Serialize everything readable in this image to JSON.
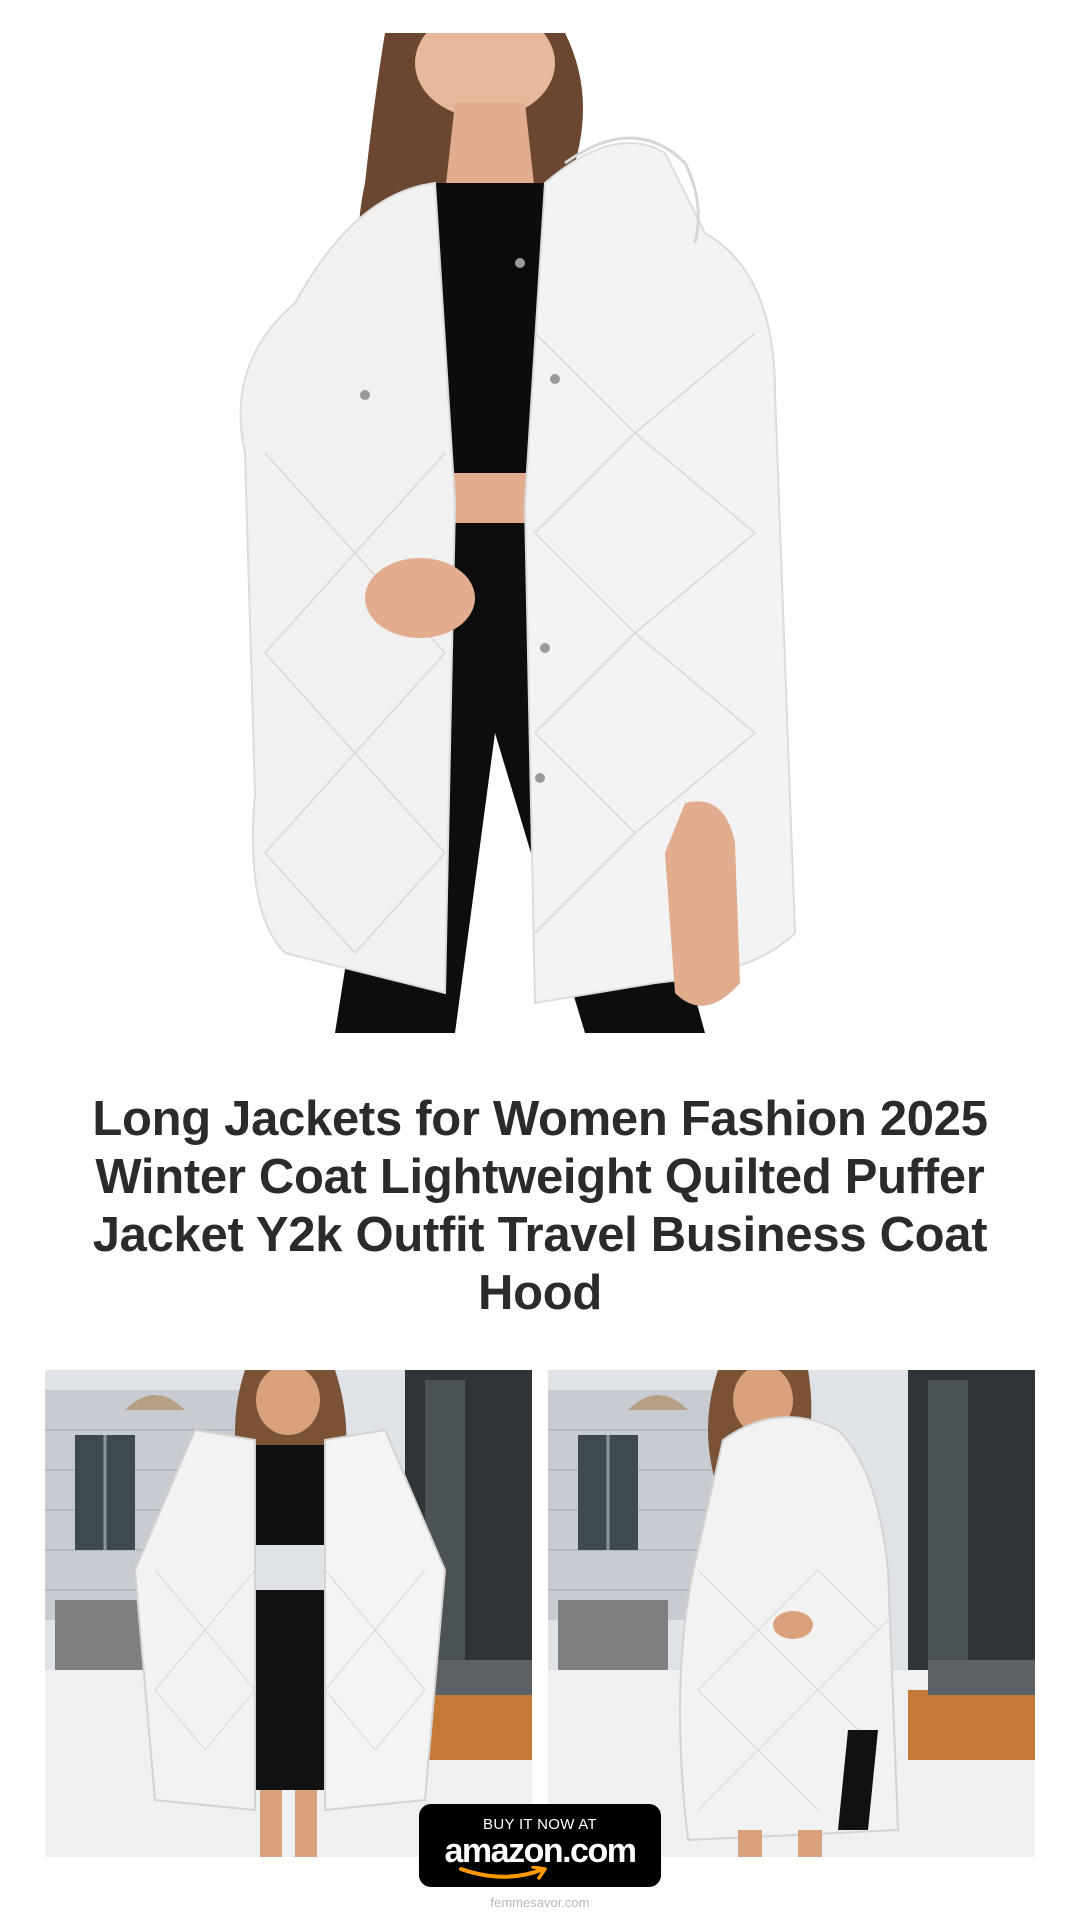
{
  "product": {
    "title": "Long Jackets for Women Fashion 2025 Winter Coat Lightweight Quilted Puffer Jacket Y2k Outfit Travel Business Coat Hood"
  },
  "images": {
    "hero_alt": "model-front-white-quilted-jacket",
    "gallery": [
      "model-front-room",
      "model-side-room"
    ]
  },
  "cta": {
    "line1": "BUY IT NOW AT",
    "brand": "amazon.com"
  },
  "footer": {
    "site": "femmesavor.com"
  },
  "colors": {
    "title": "#2b2b2b",
    "badge_bg": "#000000",
    "amazon_orange": "#ff9900",
    "jacket": "#f1f1f1"
  }
}
